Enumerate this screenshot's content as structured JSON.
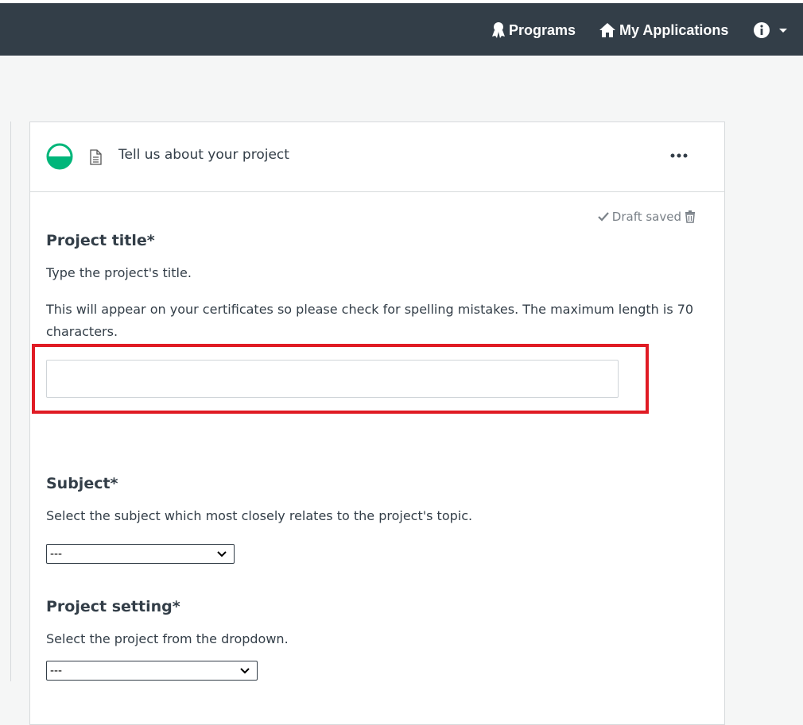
{
  "nav": {
    "programs_label": "Programs",
    "applications_label": "My Applications"
  },
  "card": {
    "title": "Tell us about your project",
    "draft_status": "Draft saved"
  },
  "fields": {
    "project_title": {
      "label": "Project title*",
      "help1": "Type the project's title.",
      "help2": "This will appear on your certificates so please check for spelling mistakes. The maximum length is 70 characters.",
      "value": ""
    },
    "subject": {
      "label": "Subject*",
      "help": "Select the subject which most closely relates to the project's topic.",
      "selected": "---"
    },
    "project_setting": {
      "label": "Project setting*",
      "help": "Select the project from the dropdown.",
      "selected": "---"
    }
  },
  "icons": {
    "programs": "award-icon",
    "applications": "home-icon",
    "info": "info-icon",
    "status": "half-circle-status-icon",
    "document": "document-icon",
    "more": "more-options-icon"
  },
  "colors": {
    "topbar": "#333e48",
    "status_green": "#00b67a",
    "highlight_red": "#e01b24"
  }
}
